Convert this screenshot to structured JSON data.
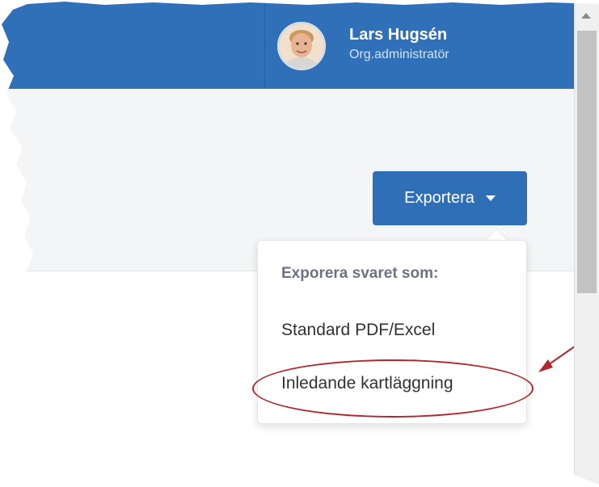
{
  "header": {
    "user_name": "Lars Hugsén",
    "user_role": "Org.administratör"
  },
  "toolbar": {
    "export_label": "Exportera"
  },
  "export_menu": {
    "header": "Exporera svaret som:",
    "items": [
      {
        "label": "Standard PDF/Excel"
      },
      {
        "label": "Inledande kartläggning"
      }
    ]
  },
  "colors": {
    "brand_blue": "#3070b8",
    "annotation_red": "#b3262d"
  }
}
